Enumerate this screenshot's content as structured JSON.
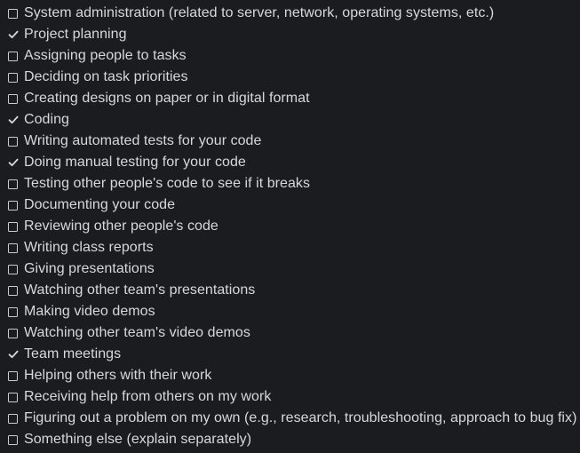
{
  "items": [
    {
      "label": "System administration (related to server, network, operating systems, etc.)",
      "checked": false
    },
    {
      "label": "Project planning",
      "checked": true
    },
    {
      "label": "Assigning people to tasks",
      "checked": false
    },
    {
      "label": "Deciding on task priorities",
      "checked": false
    },
    {
      "label": "Creating designs on paper or in digital format",
      "checked": false
    },
    {
      "label": "Coding",
      "checked": true
    },
    {
      "label": "Writing automated tests for your code",
      "checked": false
    },
    {
      "label": "Doing manual testing for your code",
      "checked": true
    },
    {
      "label": "Testing other people's code to see if it breaks",
      "checked": false
    },
    {
      "label": "Documenting your code",
      "checked": false
    },
    {
      "label": "Reviewing other people's code",
      "checked": false
    },
    {
      "label": "Writing class reports",
      "checked": false
    },
    {
      "label": "Giving presentations",
      "checked": false
    },
    {
      "label": "Watching other team's presentations",
      "checked": false
    },
    {
      "label": "Making video demos",
      "checked": false
    },
    {
      "label": "Watching other team's video demos",
      "checked": false
    },
    {
      "label": "Team meetings",
      "checked": true
    },
    {
      "label": "Helping others with their work",
      "checked": false
    },
    {
      "label": "Receiving help from others on my work",
      "checked": false
    },
    {
      "label": "Figuring out a problem on my own (e.g., research, troubleshooting, approach to bug fix)",
      "checked": false
    },
    {
      "label": "Something else (explain separately)",
      "checked": false
    }
  ],
  "colors": {
    "background": "#1b1c1f",
    "text": "#d6d8dc",
    "checkbox_border": "#c9ccd1",
    "checkmark": "#d6d8dc"
  },
  "icons": {
    "unchecked": "checkbox-empty-icon",
    "checked": "checkmark-icon"
  }
}
